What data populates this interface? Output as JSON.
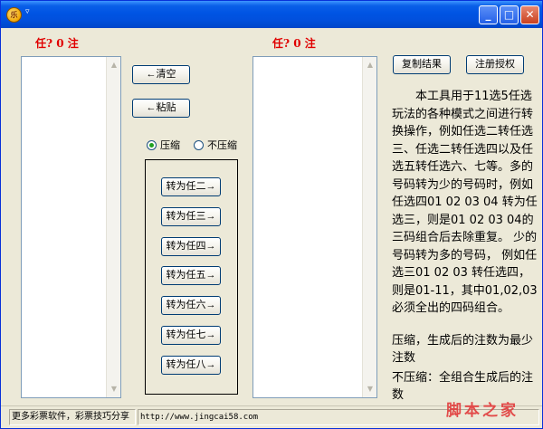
{
  "titlebar": {
    "sys_menu_glyph": "▿",
    "minimize_glyph": "_",
    "maximize_glyph": "□",
    "close_glyph": "✕"
  },
  "left_count_label": "任? 0 注",
  "right_count_label": "任? 0 注",
  "buttons": {
    "clear": "←清空",
    "paste": "←粘贴",
    "copy_result": "复制结果",
    "register": "注册授权"
  },
  "mode": {
    "options": [
      "压缩",
      "不压缩"
    ],
    "selected": "压缩"
  },
  "convert_buttons": [
    "转为任二→",
    "转为任三→",
    "转为任四→",
    "转为任五→",
    "转为任六→",
    "转为任七→",
    "转为任八→"
  ],
  "description": "本工具用于11选5任选玩法的各种模式之间进行转换操作，例如任选二转任选三、任选二转任选四以及任选五转任选六、七等。多的号码转为少的号码时，例如任选四01 02 03 04 转为任选三，则是01 02 03 04的三码组合后去除重复。 少的号码转为多的号码， 例如任选三01 02 03 转任选四，则是01-11，其中01,02,03必须全出的四码组合。",
  "note_compress": "压缩，生成后的注数为最少注数",
  "note_nocompress": "不压缩：全组合生成后的注数",
  "status": {
    "left": "更多彩票软件，彩票技巧分享",
    "right": "http://www.jingcai58.com"
  },
  "watermark": "脚本之家",
  "accent_colors": {
    "count_red": "#e00000",
    "title_blue": "#0054e3",
    "radio_green": "#21a121"
  }
}
